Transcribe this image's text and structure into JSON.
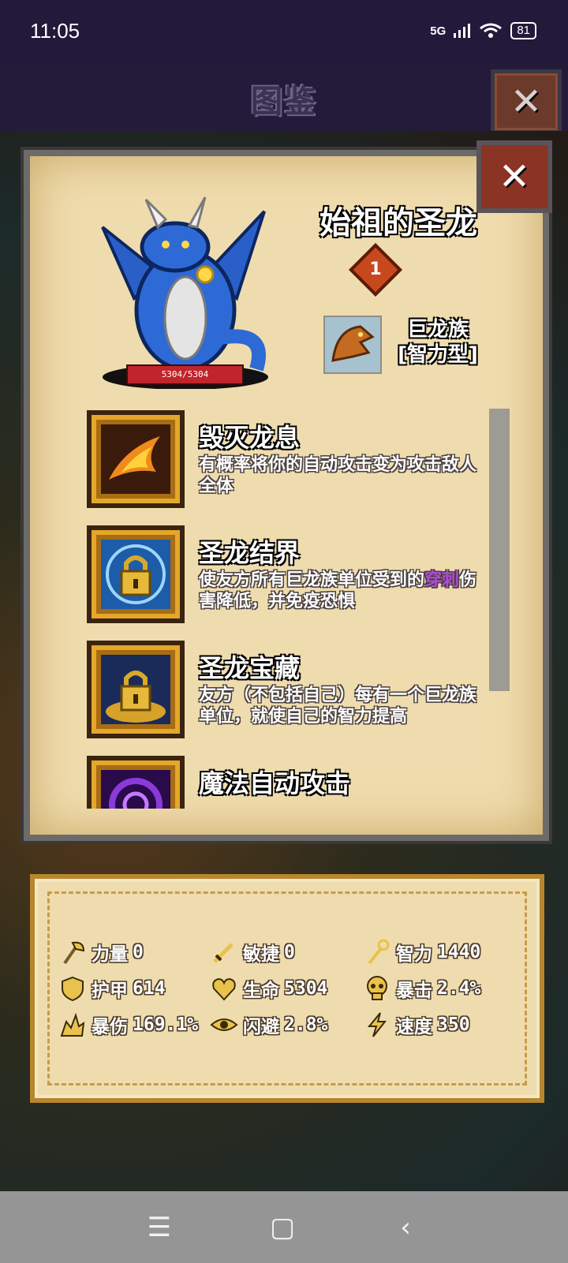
{
  "status_bar": {
    "time": "11:05",
    "network": "5G",
    "battery": "81"
  },
  "header": {
    "title": "图鉴"
  },
  "unit": {
    "name": "始祖的圣龙",
    "rank": "1",
    "hp": "5304/5304",
    "tribe_line1": "巨龙族",
    "tribe_line2": "[智力型]"
  },
  "skills": [
    {
      "title": "毁灭龙息",
      "desc": "有概率将你的自动攻击变为攻击敌人全体"
    },
    {
      "title": "圣龙结界",
      "desc_highlight_before": "使友方所有巨龙族单位受到的",
      "desc_highlight": "穿刺",
      "desc_after": "伤害降低，并免疫恐惧"
    },
    {
      "title": "圣龙宝藏",
      "desc": "友方（不包括自己）每有一个巨龙族单位，就使自己的智力提高"
    },
    {
      "title": "魔法自动攻击",
      "desc": ""
    }
  ],
  "stats": [
    {
      "label": "力量",
      "value": "0",
      "icon": "axe-icon"
    },
    {
      "label": "敏捷",
      "value": "0",
      "icon": "sword-icon"
    },
    {
      "label": "智力",
      "value": "1440",
      "icon": "staff-icon"
    },
    {
      "label": "护甲",
      "value": "614",
      "icon": "shield-icon"
    },
    {
      "label": "生命",
      "value": "5304",
      "icon": "heart-icon"
    },
    {
      "label": "暴击",
      "value": "2.4%",
      "icon": "skull-icon"
    },
    {
      "label": "暴伤",
      "value": "169.1%",
      "icon": "burst-icon"
    },
    {
      "label": "闪避",
      "value": "2.8%",
      "icon": "eye-icon"
    },
    {
      "label": "速度",
      "value": "350",
      "icon": "lightning-icon"
    }
  ],
  "colors": {
    "parchment": "#efdcae",
    "highlight": "#b04ad6",
    "close_red": "#8b3324"
  }
}
